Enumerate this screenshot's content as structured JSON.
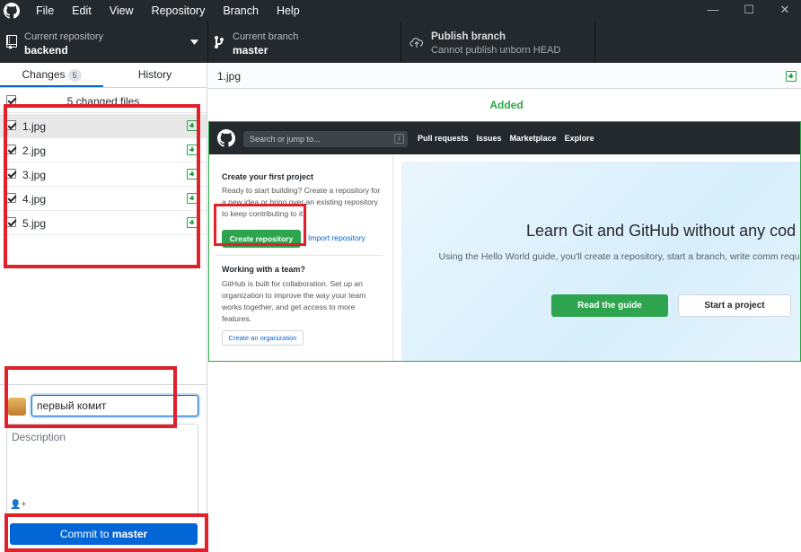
{
  "menu": [
    "File",
    "Edit",
    "View",
    "Repository",
    "Branch",
    "Help"
  ],
  "window_controls": {
    "minimize": "—",
    "maximize": "☐",
    "close": "✕"
  },
  "toolbar": {
    "repo_label": "Current repository",
    "repo_value": "backend",
    "branch_label": "Current branch",
    "branch_value": "master",
    "publish_label": "Publish branch",
    "publish_sub": "Cannot publish unborn HEAD"
  },
  "sidebar": {
    "tabs": {
      "changes": "Changes",
      "changes_count": "5",
      "history": "History"
    },
    "changed_files_label": "5 changed files",
    "files": [
      {
        "name": "1.jpg",
        "status": "added"
      },
      {
        "name": "2.jpg",
        "status": "added"
      },
      {
        "name": "3.jpg",
        "status": "added"
      },
      {
        "name": "4.jpg",
        "status": "added"
      },
      {
        "name": "5.jpg",
        "status": "added"
      }
    ],
    "commit": {
      "summary_value": "первый комит",
      "description_placeholder": "Description",
      "coauthor_icon": "+",
      "button_prefix": "Commit to ",
      "button_branch": "master"
    }
  },
  "main": {
    "file_name": "1.jpg",
    "status": "Added",
    "preview": {
      "search_placeholder": "Search or jump to...",
      "search_key": "/",
      "nav": [
        "Pull requests",
        "Issues",
        "Marketplace",
        "Explore"
      ],
      "first_project_title": "Create your first project",
      "first_project_text": "Ready to start building? Create a repository for a new idea or bring over an existing repository to keep contributing to it.",
      "create_repo": "Create repository",
      "import_repo": "Import repository",
      "team_title": "Working with a team?",
      "team_text": "GitHub is built for collaboration. Set up an organization to improve the way your team works together, and get access to more features.",
      "create_org": "Create an organization",
      "hero_title": "Learn Git and GitHub without any cod",
      "hero_sub": "Using the Hello World guide, you'll create a repository, start a branch, write comm request.",
      "read_guide": "Read the guide",
      "start_project": "Start a project"
    }
  },
  "colors": {
    "accent": "#0366d6",
    "added": "#28a745",
    "highlight": "#e0202a",
    "dark": "#24292e"
  }
}
